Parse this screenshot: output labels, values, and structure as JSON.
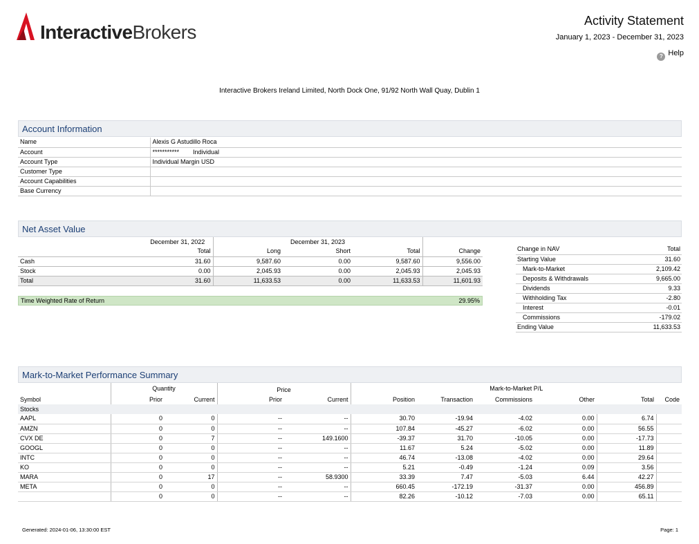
{
  "brand": {
    "name_bold": "Interactive",
    "name_light": "Brokers",
    "mark_color": "#d81222"
  },
  "header": {
    "title": "Activity Statement",
    "period": "January 1, 2023 - December 31, 2023",
    "help_label": "Help",
    "help_glyph": "?"
  },
  "address": "Interactive Brokers Ireland Limited, North Dock One, 91/92 North Wall Quay, Dublin 1",
  "account_info": {
    "title": "Account Information",
    "rows": [
      {
        "label": "Name",
        "value": "Alexis G Astudillo Roca",
        "value2": ""
      },
      {
        "label": "Account",
        "value": "***********",
        "value2": "Individual"
      },
      {
        "label": "Account Type",
        "value": "Individual Margin USD",
        "value2": ""
      },
      {
        "label": "Customer Type",
        "value": "",
        "value2": ""
      },
      {
        "label": "Account Capabilities",
        "value": "",
        "value2": ""
      },
      {
        "label": "Base Currency",
        "value": "",
        "value2": ""
      }
    ]
  },
  "nav": {
    "title": "Net Asset Value",
    "prior_period": "December 31, 2022",
    "current_period": "December 31, 2023",
    "columns": {
      "total": "Total",
      "long": "Long",
      "short": "Short",
      "change": "Change"
    },
    "rows": [
      {
        "label": "Cash",
        "prior_total": "31.60",
        "long": "9,587.60",
        "short": "0.00",
        "total": "9,587.60",
        "change": "9,556.00"
      },
      {
        "label": "Stock",
        "prior_total": "0.00",
        "long": "2,045.93",
        "short": "0.00",
        "total": "2,045.93",
        "change": "2,045.93"
      },
      {
        "label": "Total",
        "prior_total": "31.60",
        "long": "11,633.53",
        "short": "0.00",
        "total": "11,633.53",
        "change": "11,601.93"
      }
    ],
    "twr_label": "Time Weighted Rate of Return",
    "twr_value": "29.95%"
  },
  "change_in_nav": {
    "header_label": "Change in NAV",
    "header_total": "Total",
    "rows": [
      {
        "label": "Starting Value",
        "value": "31.60"
      },
      {
        "label": "Mark-to-Market",
        "value": "2,109.42"
      },
      {
        "label": "Deposits & Withdrawals",
        "value": "9,665.00"
      },
      {
        "label": "Dividends",
        "value": "9.33"
      },
      {
        "label": "Withholding Tax",
        "value": "-2.80"
      },
      {
        "label": "Interest",
        "value": "-0.01"
      },
      {
        "label": "Commissions",
        "value": "-179.02"
      },
      {
        "label": "Ending Value",
        "value": "11,633.53"
      }
    ]
  },
  "mtm": {
    "title": "Mark-to-Market Performance Summary",
    "groups": {
      "quantity": "Quantity",
      "price": "Price",
      "pl": "Mark-to-Market P/L"
    },
    "columns": {
      "symbol": "Symbol",
      "prior": "Prior",
      "current": "Current",
      "position": "Position",
      "transaction": "Transaction",
      "commissions": "Commissions",
      "other": "Other",
      "total": "Total",
      "code": "Code"
    },
    "category": "Stocks",
    "rows": [
      {
        "symbol": "AAPL",
        "q_prior": "0",
        "q_current": "0",
        "p_prior": "--",
        "p_current": "--",
        "position": "30.70",
        "transaction": "-19.94",
        "commissions": "-4.02",
        "other": "0.00",
        "total": "6.74",
        "code": ""
      },
      {
        "symbol": "AMZN",
        "q_prior": "0",
        "q_current": "0",
        "p_prior": "--",
        "p_current": "--",
        "position": "107.84",
        "transaction": "-45.27",
        "commissions": "-6.02",
        "other": "0.00",
        "total": "56.55",
        "code": ""
      },
      {
        "symbol": "CVX DE",
        "q_prior": "0",
        "q_current": "7",
        "p_prior": "--",
        "p_current": "149.1600",
        "position": "-39.37",
        "transaction": "31.70",
        "commissions": "-10.05",
        "other": "0.00",
        "total": "-17.73",
        "code": ""
      },
      {
        "symbol": "GOOGL",
        "q_prior": "0",
        "q_current": "0",
        "p_prior": "--",
        "p_current": "--",
        "position": "11.67",
        "transaction": "5.24",
        "commissions": "-5.02",
        "other": "0.00",
        "total": "11.89",
        "code": ""
      },
      {
        "symbol": "INTC",
        "q_prior": "0",
        "q_current": "0",
        "p_prior": "--",
        "p_current": "--",
        "position": "46.74",
        "transaction": "-13.08",
        "commissions": "-4.02",
        "other": "0.00",
        "total": "29.64",
        "code": ""
      },
      {
        "symbol": "KO",
        "q_prior": "0",
        "q_current": "0",
        "p_prior": "--",
        "p_current": "--",
        "position": "5.21",
        "transaction": "-0.49",
        "commissions": "-1.24",
        "other": "0.09",
        "total": "3.56",
        "code": ""
      },
      {
        "symbol": "MARA",
        "q_prior": "0",
        "q_current": "17",
        "p_prior": "--",
        "p_current": "58.9300",
        "position": "33.39",
        "transaction": "7.47",
        "commissions": "-5.03",
        "other": "6.44",
        "total": "42.27",
        "code": ""
      },
      {
        "symbol": "META",
        "q_prior": "0",
        "q_current": "0",
        "p_prior": "--",
        "p_current": "--",
        "position": "660.45",
        "transaction": "-172.19",
        "commissions": "-31.37",
        "other": "0.00",
        "total": "456.89",
        "code": ""
      },
      {
        "symbol": "",
        "q_prior": "0",
        "q_current": "0",
        "p_prior": "--",
        "p_current": "--",
        "position": "82.26",
        "transaction": "-10.12",
        "commissions": "-7.03",
        "other": "0.00",
        "total": "65.11",
        "code": ""
      }
    ]
  },
  "footer": {
    "generated": "Generated: 2024-01-06, 13:30:00 EST",
    "page": "Page: 1"
  }
}
